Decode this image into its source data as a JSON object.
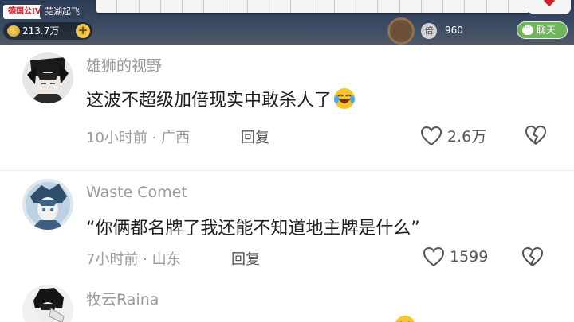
{
  "game": {
    "room_tag": "德国公IV",
    "player_name": "芜湖起飞",
    "coins": "213.7万",
    "coin_plus": "+",
    "bet_icon": "倍",
    "bet_value": "960",
    "chat_label": "聊天"
  },
  "comments": [
    {
      "username": "雄狮的视野",
      "content": "这波不超级加倍现实中敢杀人了",
      "emoji": "crying-laughing-emoji",
      "time": "10小时前",
      "region": "广西",
      "reply_label": "回复",
      "likes": "2.6万"
    },
    {
      "username": "Waste Comet",
      "content": "“你俩都名牌了我还能不知道地主牌是什么”",
      "time": "7小时前",
      "region": "山东",
      "reply_label": "回复",
      "likes": "1599"
    },
    {
      "username": "牧云Raina",
      "emoji": "crying-laughing-emoji"
    }
  ],
  "separator": " · ",
  "colors": {
    "username": "#9a9a9a",
    "text": "#1e1e1e",
    "chat_button": "#6fb35a",
    "card_red": "#d21f2b"
  }
}
